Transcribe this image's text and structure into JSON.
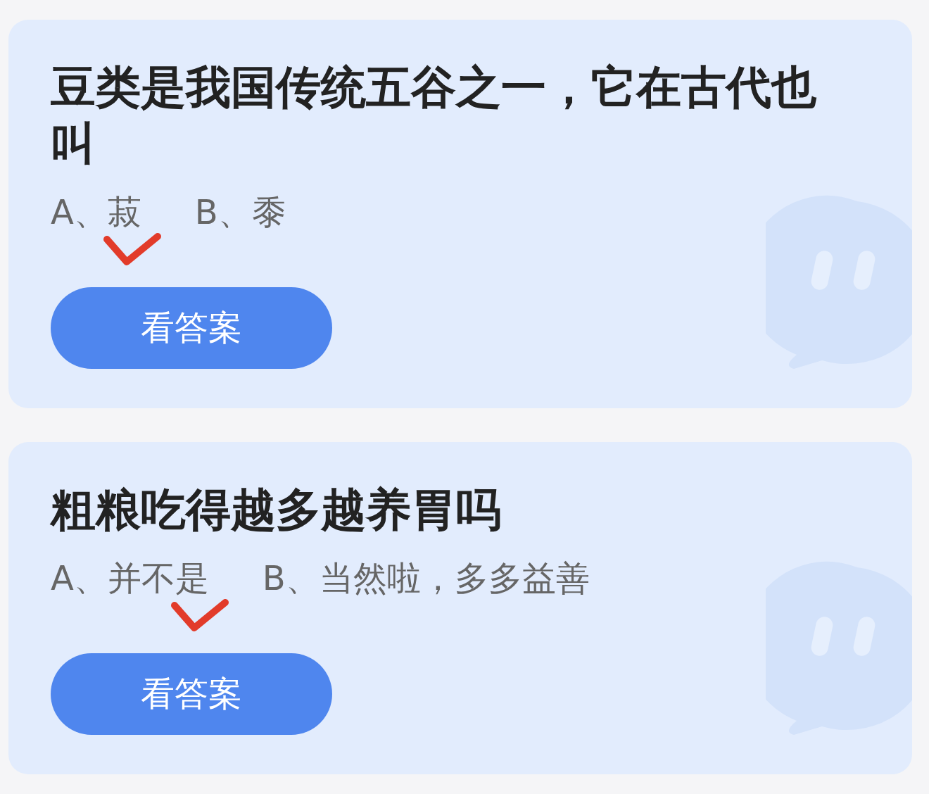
{
  "questions": [
    {
      "question": "豆类是我国传统五谷之一，它在古代也叫",
      "options": [
        {
          "text": "A、菽",
          "marked": true
        },
        {
          "text": "B、黍",
          "marked": false
        }
      ],
      "button": "看答案"
    },
    {
      "question": "粗粮吃得越多越养胃吗",
      "options": [
        {
          "text": "A、并不是",
          "marked": true
        },
        {
          "text": "B、当然啦，多多益善",
          "marked": false
        }
      ],
      "button": "看答案"
    }
  ]
}
